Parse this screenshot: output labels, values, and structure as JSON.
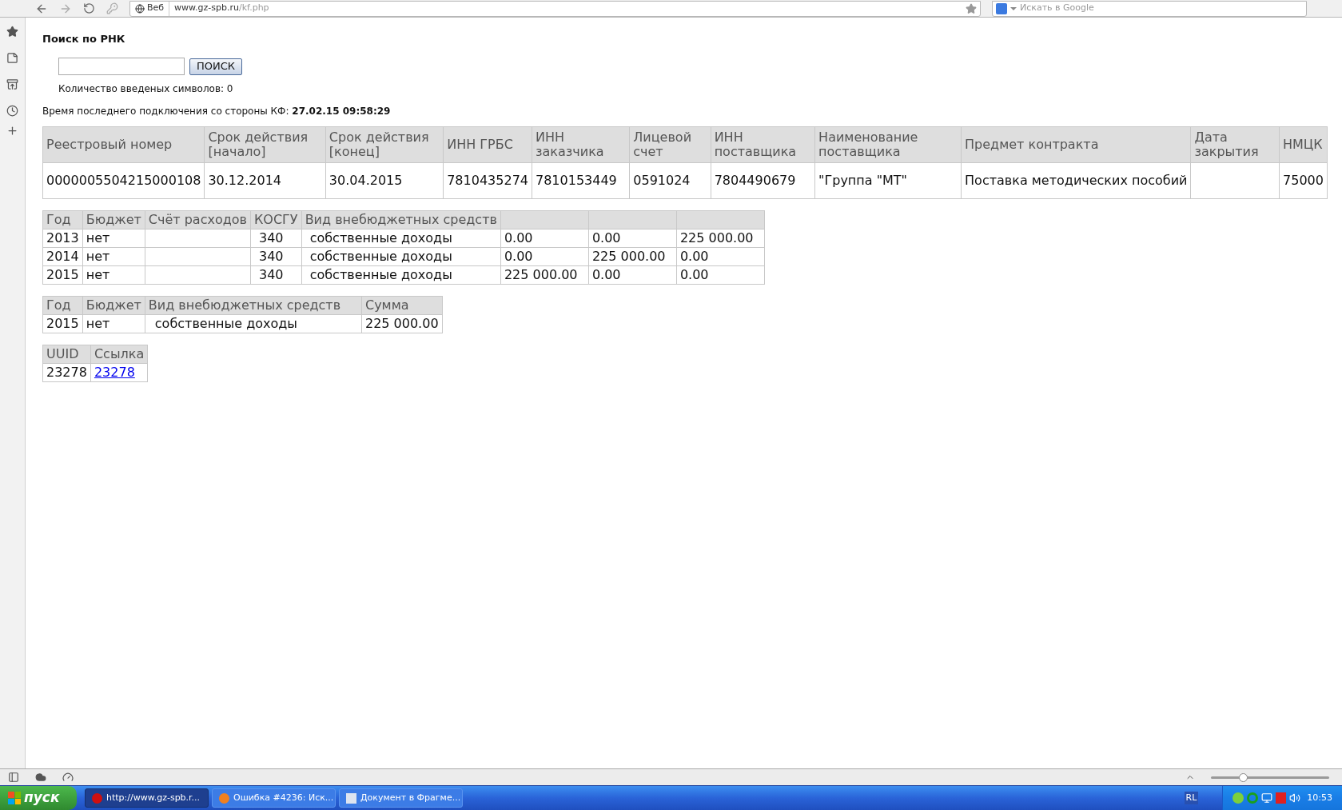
{
  "browser": {
    "search_engine_label": "Веб",
    "url_host": "www.gz-spb.ru",
    "url_path": "/kf.php",
    "search_placeholder": "Искать в Google",
    "zoom": {
      "level": 0.27
    }
  },
  "page": {
    "title": "Поиск по РНК",
    "search_button": "ПОИСК",
    "char_count": "Количество введеных символов: 0",
    "last_connection_label": "Время последнего подключения со стороны КФ:",
    "last_connection_value": "27.02.15 09:58:29"
  },
  "contract_table": {
    "columns": [
      "Реестровый номер",
      "Срок действия [начало]",
      "Срок действия [конец]",
      "ИНН ГРБС",
      "ИНН заказчика",
      "Лицевой счет",
      "ИНН поставщика",
      "Наименование поставщика",
      "Предмет контракта",
      "Дата закрытия",
      "НМЦК"
    ],
    "rows": [
      [
        "0000005504215000108",
        "30.12.2014",
        "30.04.2015",
        "7810435274",
        "7810153449",
        "0591024",
        "7804490679",
        "\"Группа \"МТ\"",
        "Поставка методических пособий",
        null,
        "75000"
      ]
    ]
  },
  "finance_table": {
    "columns": [
      "Год",
      "Бюджет",
      "Счёт расходов",
      "КОСГУ",
      "Вид внебюджетных средств"
    ],
    "rows": [
      [
        "2013",
        "нет",
        null,
        "340",
        "собственные доходы",
        "0.00",
        "0.00",
        "225 000.00"
      ],
      [
        "2014",
        "нет",
        null,
        "340",
        "собственные доходы",
        "0.00",
        "225 000.00",
        "0.00"
      ],
      [
        "2015",
        "нет",
        null,
        "340",
        "собственные доходы",
        "225 000.00",
        "0.00",
        "0.00"
      ]
    ]
  },
  "sum_table": {
    "columns": [
      "Год",
      "Бюджет",
      "Вид внебюджетных средств",
      "Сумма"
    ],
    "rows": [
      [
        "2015",
        "нет",
        "собственные доходы",
        "225 000.00"
      ]
    ]
  },
  "uuid_table": {
    "columns": [
      "UUID",
      "Ссылка"
    ],
    "rows": [
      {
        "uuid": "23278",
        "link": "23278"
      }
    ]
  },
  "taskbar": {
    "start_label": "пуск",
    "tasks": [
      {
        "label": "http://www.gz-spb.r...",
        "selected": true
      },
      {
        "label": "Ошибка #4236: Иск...",
        "selected": false
      },
      {
        "label": "Документ в Фрагме...",
        "selected": false
      }
    ],
    "language": "RL",
    "clock": "10:53"
  }
}
